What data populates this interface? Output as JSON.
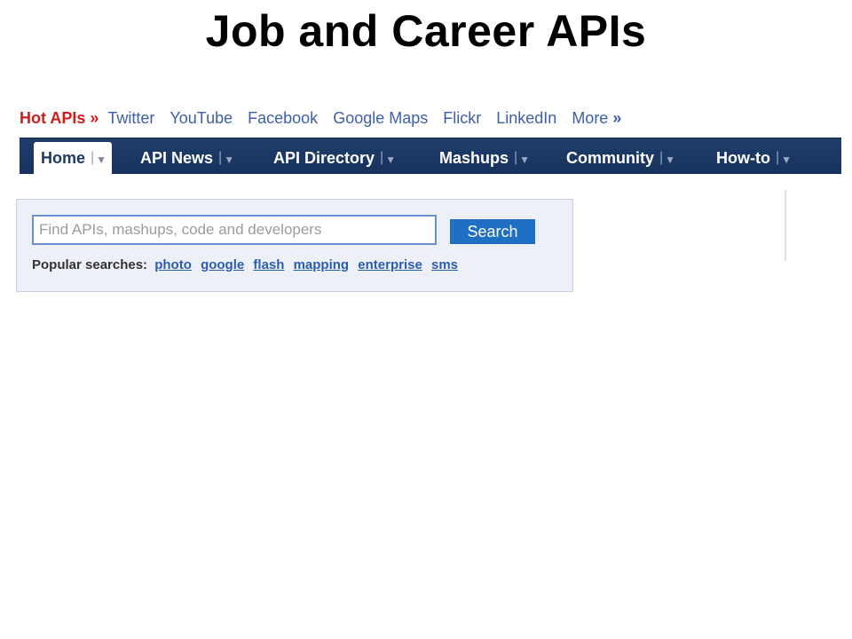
{
  "slide": {
    "title": "Job and Career APIs"
  },
  "hot_apis": {
    "label": "Hot APIs",
    "arrow": "»",
    "links": [
      "Twitter",
      "YouTube",
      "Facebook",
      "Google Maps",
      "Flickr",
      "LinkedIn"
    ],
    "more_label": "More",
    "more_arrow": "»"
  },
  "nav": {
    "tabs": [
      {
        "label": "Home",
        "active": true
      },
      {
        "label": "API News",
        "active": false
      },
      {
        "label": "API Directory",
        "active": false
      },
      {
        "label": "Mashups",
        "active": false
      },
      {
        "label": "Community",
        "active": false
      },
      {
        "label": "How-to",
        "active": false
      }
    ],
    "separator": "|",
    "caret": "▼"
  },
  "search": {
    "placeholder": "Find APIs, mashups, code and developers",
    "button_label": "Search",
    "popular_label": "Popular searches:",
    "popular_terms": [
      "photo",
      "google",
      "flash",
      "mapping",
      "enterprise",
      "sms"
    ]
  },
  "colors": {
    "hot_label": "#d31c1c",
    "link": "#3d5fa8",
    "navbar": "#1f3d6b",
    "search_button": "#1f6fc5",
    "panel_bg": "#eef0f8"
  }
}
